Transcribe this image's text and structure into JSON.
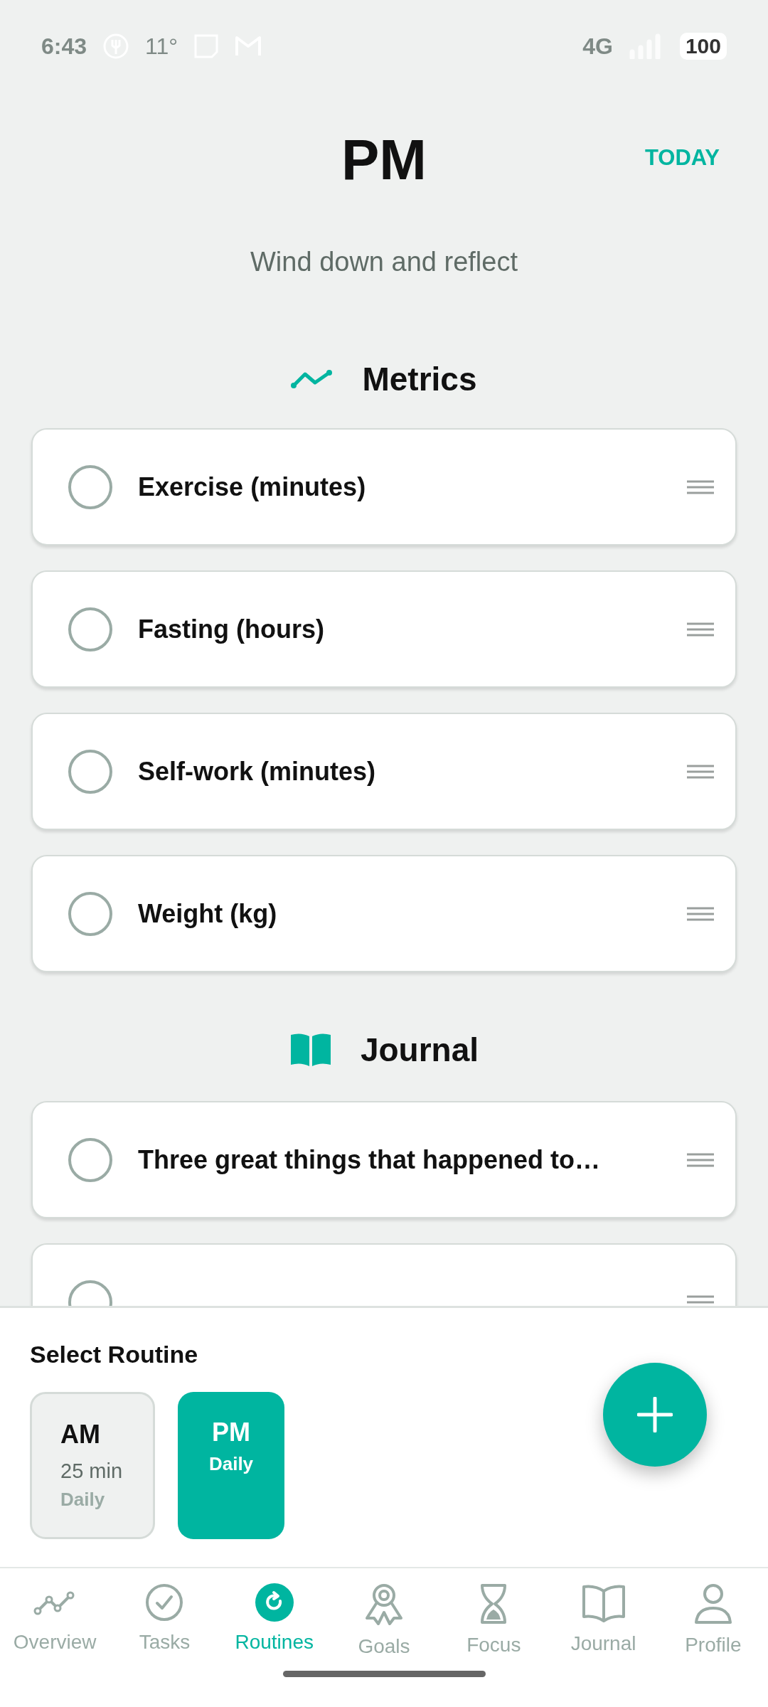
{
  "status_bar": {
    "time": "6:43",
    "temperature": "11°",
    "network": "4G",
    "battery": "100"
  },
  "header": {
    "title": "PM",
    "action": "TODAY",
    "subtitle": "Wind down and reflect"
  },
  "sections": [
    {
      "title": "Metrics",
      "kind": "metrics",
      "items": [
        {
          "label": "Exercise (minutes)",
          "checked": false
        },
        {
          "label": "Fasting (hours)",
          "checked": false
        },
        {
          "label": "Self-work (minutes)",
          "checked": false
        },
        {
          "label": "Weight (kg)",
          "checked": false
        }
      ]
    },
    {
      "title": "Journal",
      "kind": "journal",
      "items": [
        {
          "label": "Three great things that happened to…",
          "checked": false
        },
        {
          "checked": false
        }
      ]
    }
  ],
  "routine_picker": {
    "title": "Select Routine",
    "routines": [
      {
        "name": "AM",
        "duration": "25 min",
        "frequency": "Daily",
        "selected": false
      },
      {
        "name": "PM",
        "frequency": "Daily",
        "selected": true
      }
    ]
  },
  "nav": [
    {
      "label": "Overview",
      "kind": "overview",
      "selected": false
    },
    {
      "label": "Tasks",
      "kind": "tasks",
      "selected": false
    },
    {
      "label": "Routines",
      "kind": "routines",
      "selected": true
    },
    {
      "label": "Goals",
      "kind": "goals",
      "selected": false
    },
    {
      "label": "Focus",
      "kind": "focus",
      "selected": false
    },
    {
      "label": "Journal",
      "kind": "journal",
      "selected": false
    },
    {
      "label": "Profile",
      "kind": "profile",
      "selected": false
    }
  ]
}
